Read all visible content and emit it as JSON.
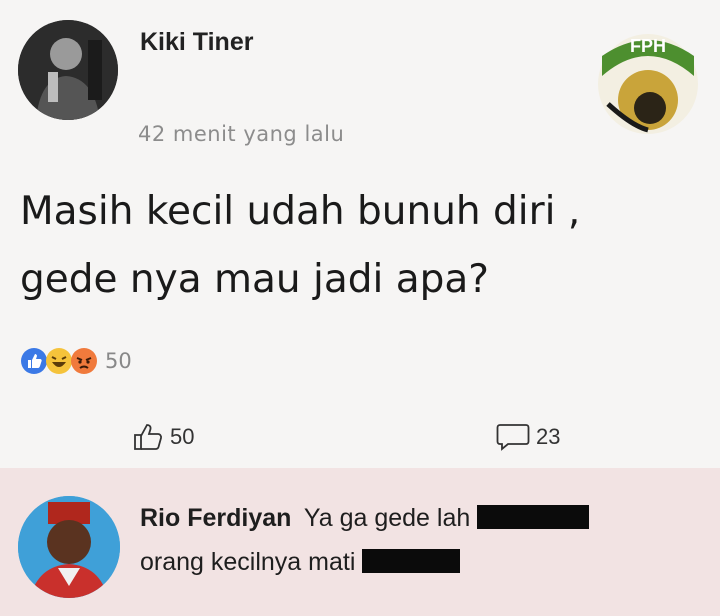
{
  "post": {
    "author": "Kiki Tiner",
    "timestamp": "42 menit yang lalu",
    "page_logo_text": "FPH",
    "text_line1": "Masih kecil udah bunuh diri ,",
    "text_line2": "gede nya mau jadi apa?",
    "reactions": {
      "icons": [
        "like-icon",
        "laugh-icon",
        "angry-icon"
      ],
      "count": "50"
    },
    "actions": {
      "like_count": "50",
      "comment_count": "23"
    }
  },
  "comment": {
    "author": "Rio Ferdiyan",
    "text_part1": "Ya ga gede lah",
    "text_part2": "orang kecilnya mati"
  },
  "colors": {
    "like_blue": "#3b79e6",
    "comment_bg": "#f2e3e3",
    "censor": "#0b0b0b"
  }
}
